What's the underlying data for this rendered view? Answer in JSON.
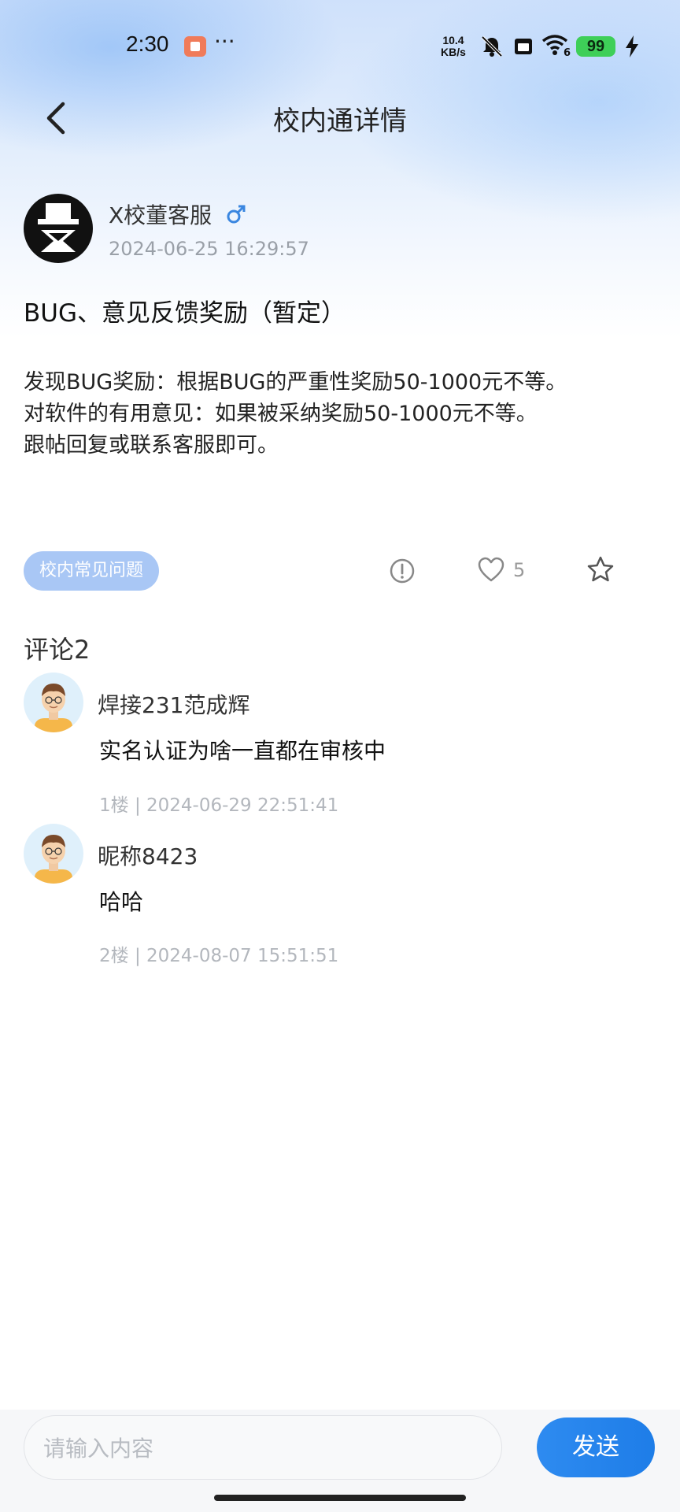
{
  "status_bar": {
    "time": "2:30",
    "more": "···",
    "net_speed_value": "10.4",
    "net_speed_unit": "KB/s",
    "wifi_sub": "6",
    "battery": "99"
  },
  "header": {
    "title": "校内通详情"
  },
  "post": {
    "author": "X校董客服",
    "time": "2024-06-25 16:29:57",
    "title": "BUG、意见反馈奖励（暂定）",
    "body": [
      "发现BUG奖励：根据BUG的严重性奖励50-1000元不等。",
      "对软件的有用意见：如果被采纳奖励50-1000元不等。",
      "跟帖回复或联系客服即可。"
    ],
    "tag": "校内常见问题",
    "like_count": "5"
  },
  "comments": {
    "title": "评论2",
    "items": [
      {
        "name": "焊接231范成辉",
        "text": "实名认证为啥一直都在审核中",
        "meta": "1楼 | 2024-06-29 22:51:41"
      },
      {
        "name": "昵称8423",
        "text": "哈哈",
        "meta": "2楼 | 2024-08-07 15:51:51"
      }
    ]
  },
  "composer": {
    "placeholder": "请输入内容",
    "send_label": "发送"
  },
  "colors": {
    "accent": "#1e7de8",
    "tag_bg": "#a9c7f5",
    "battery": "#3ecf58"
  }
}
